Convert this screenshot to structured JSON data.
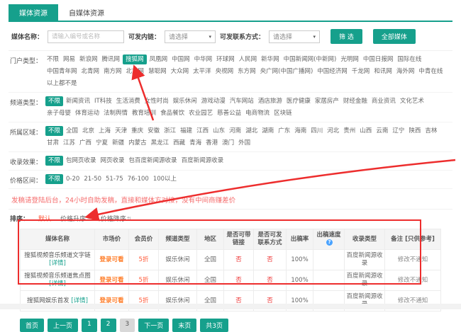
{
  "tabs": [
    {
      "label": "媒体资源",
      "active": true
    },
    {
      "label": "自媒体资源",
      "active": false
    }
  ],
  "filters": {
    "media_name_label": "媒体名称：",
    "media_name_placeholder": "请输入编号或名称",
    "inlink_label": "可发内链：",
    "inlink_value": "请选择",
    "contact_label": "可发联系方式：",
    "contact_value": "请选择",
    "search_button": "筛 选",
    "all_media_button": "全部媒体"
  },
  "filter_sections": [
    {
      "label": "门户类型：",
      "items": [
        {
          "label": "不限"
        },
        {
          "label": "网易"
        },
        {
          "label": "新浪网"
        },
        {
          "label": "腾讯网"
        },
        {
          "label": "搜狐网",
          "on": true
        },
        {
          "label": "凤凰网"
        },
        {
          "label": "中国网"
        },
        {
          "label": "中华网"
        },
        {
          "label": "环球网"
        },
        {
          "label": "人民网"
        },
        {
          "label": "新华网"
        },
        {
          "label": "中国新闻网(中新网)"
        },
        {
          "label": "光明网"
        },
        {
          "label": "中国日报网"
        },
        {
          "label": "国际在线"
        },
        {
          "label": "中国青年网"
        },
        {
          "label": "北青网"
        },
        {
          "label": "南方网"
        },
        {
          "label": "北方网"
        },
        {
          "label": "慧聪网"
        },
        {
          "label": "大众网"
        },
        {
          "label": "太平洋"
        },
        {
          "label": "央视网"
        },
        {
          "label": "东方网"
        },
        {
          "label": "央广网(中国广播网)"
        },
        {
          "label": "中国经济网"
        },
        {
          "label": "千龙网"
        },
        {
          "label": "和讯网"
        },
        {
          "label": "海外网"
        },
        {
          "label": "中青在线"
        },
        {
          "label": "以上都不是"
        }
      ]
    },
    {
      "label": "频道类型：",
      "items": [
        {
          "label": "不限",
          "on": true
        },
        {
          "label": "新闻资讯"
        },
        {
          "label": "IT科技"
        },
        {
          "label": "生活消费"
        },
        {
          "label": "女性时尚"
        },
        {
          "label": "娱乐休闲"
        },
        {
          "label": "游戏动漫"
        },
        {
          "label": "汽车网站"
        },
        {
          "label": "酒店旅游"
        },
        {
          "label": "医疗健康"
        },
        {
          "label": "家居房产"
        },
        {
          "label": "财经金融"
        },
        {
          "label": "商业资讯"
        },
        {
          "label": "文化艺术"
        },
        {
          "label": "亲子母婴"
        },
        {
          "label": "体育运动"
        },
        {
          "label": "法制舆情"
        },
        {
          "label": "教育培训"
        },
        {
          "label": "食品餐饮"
        },
        {
          "label": "农业园艺"
        },
        {
          "label": "慈善公益"
        },
        {
          "label": "电商物流"
        },
        {
          "label": "区块链"
        }
      ]
    },
    {
      "label": "所属区域：",
      "items": [
        {
          "label": "不限",
          "on": true
        },
        {
          "label": "全国"
        },
        {
          "label": "北京"
        },
        {
          "label": "上海"
        },
        {
          "label": "天津"
        },
        {
          "label": "重庆"
        },
        {
          "label": "安徽"
        },
        {
          "label": "浙江"
        },
        {
          "label": "福建"
        },
        {
          "label": "江西"
        },
        {
          "label": "山东"
        },
        {
          "label": "河南"
        },
        {
          "label": "湖北"
        },
        {
          "label": "湖南"
        },
        {
          "label": "广东"
        },
        {
          "label": "海南"
        },
        {
          "label": "四川"
        },
        {
          "label": "河北"
        },
        {
          "label": "贵州"
        },
        {
          "label": "山西"
        },
        {
          "label": "云南"
        },
        {
          "label": "辽宁"
        },
        {
          "label": "陕西"
        },
        {
          "label": "吉林"
        },
        {
          "label": "甘肃"
        },
        {
          "label": "江苏"
        },
        {
          "label": "广西"
        },
        {
          "label": "宁夏"
        },
        {
          "label": "新疆"
        },
        {
          "label": "内蒙古"
        },
        {
          "label": "黑龙江"
        },
        {
          "label": "西藏"
        },
        {
          "label": "青海"
        },
        {
          "label": "香港"
        },
        {
          "label": "澳门"
        },
        {
          "label": "外国"
        }
      ]
    },
    {
      "label": "收录效果：",
      "items": [
        {
          "label": "不限",
          "on": true
        },
        {
          "label": "包网页收录"
        },
        {
          "label": "网页收录"
        },
        {
          "label": "包百度新闻源收录"
        },
        {
          "label": "百度新闻源收录"
        }
      ]
    },
    {
      "label": "价格区间：",
      "items": [
        {
          "label": "不限",
          "on": true
        },
        {
          "label": "0-20"
        },
        {
          "label": "21-50"
        },
        {
          "label": "51-75"
        },
        {
          "label": "76-100"
        },
        {
          "label": "100以上"
        }
      ]
    }
  ],
  "notice": "发稿请登陆后台，24小时自助发稿，直接和媒体方对接，没有中间商赚差价",
  "sort": {
    "label": "排序：",
    "default": "默认",
    "asc": "价格升序",
    "desc": "价格降序"
  },
  "table": {
    "headers": [
      {
        "label": "媒体名称"
      },
      {
        "label": "市场价"
      },
      {
        "label": "会员价"
      },
      {
        "label": "频道类型"
      },
      {
        "label": "地区"
      },
      {
        "label": "是否可带链接"
      },
      {
        "label": "是否可发联系方式"
      },
      {
        "label": "出稿率"
      },
      {
        "label": "出稿速度",
        "help": true
      },
      {
        "label": "收录类型"
      },
      {
        "label": "备注 [只供参考]"
      }
    ],
    "rows": [
      {
        "name": "搜狐视频音乐频道文字链",
        "detail": "[详情]",
        "market_price": "登录可看",
        "member_price": "5折",
        "channel": "娱乐休闲",
        "region": "全国",
        "can_link": "否",
        "can_contact": "否",
        "publish_rate": "100%",
        "publish_speed": "",
        "include_type": "百度新闻源收录",
        "note": "修改不通知"
      },
      {
        "name": "搜狐视频音乐频道焦点图",
        "detail": "[详情]",
        "market_price": "登录可看",
        "member_price": "5折",
        "channel": "娱乐休闲",
        "region": "全国",
        "can_link": "否",
        "can_contact": "否",
        "publish_rate": "100%",
        "publish_speed": "",
        "include_type": "百度新闻源收录",
        "note": "修改不通知"
      },
      {
        "name": "搜狐网娱乐首发",
        "detail": "[详情]",
        "market_price": "登录可看",
        "member_price": "5折",
        "channel": "娱乐休闲",
        "region": "全国",
        "can_link": "否",
        "can_contact": "否",
        "publish_rate": "100%",
        "publish_speed": "",
        "include_type": "百度新闻源收录",
        "note": "修改不通知"
      }
    ]
  },
  "pagination": {
    "items": [
      {
        "label": "首页"
      },
      {
        "label": "上一页"
      },
      {
        "label": "1"
      },
      {
        "label": "2"
      },
      {
        "label": "3",
        "current": true
      },
      {
        "label": "下一页"
      },
      {
        "label": "末页"
      },
      {
        "label": "共3页"
      }
    ]
  },
  "colors": {
    "accent_teal": "#16A08C",
    "notice_red": "#f56b6b",
    "market_orange": "#ff7e2a",
    "member_orange_red": "#ff5b3a",
    "no_red": "#ee3b3b",
    "annotation_red": "#ed2d2d",
    "help_blue": "#4aa3ff"
  },
  "icons": {
    "select_caret": "▾",
    "sort_updown": "⇅",
    "help_question": "?"
  }
}
